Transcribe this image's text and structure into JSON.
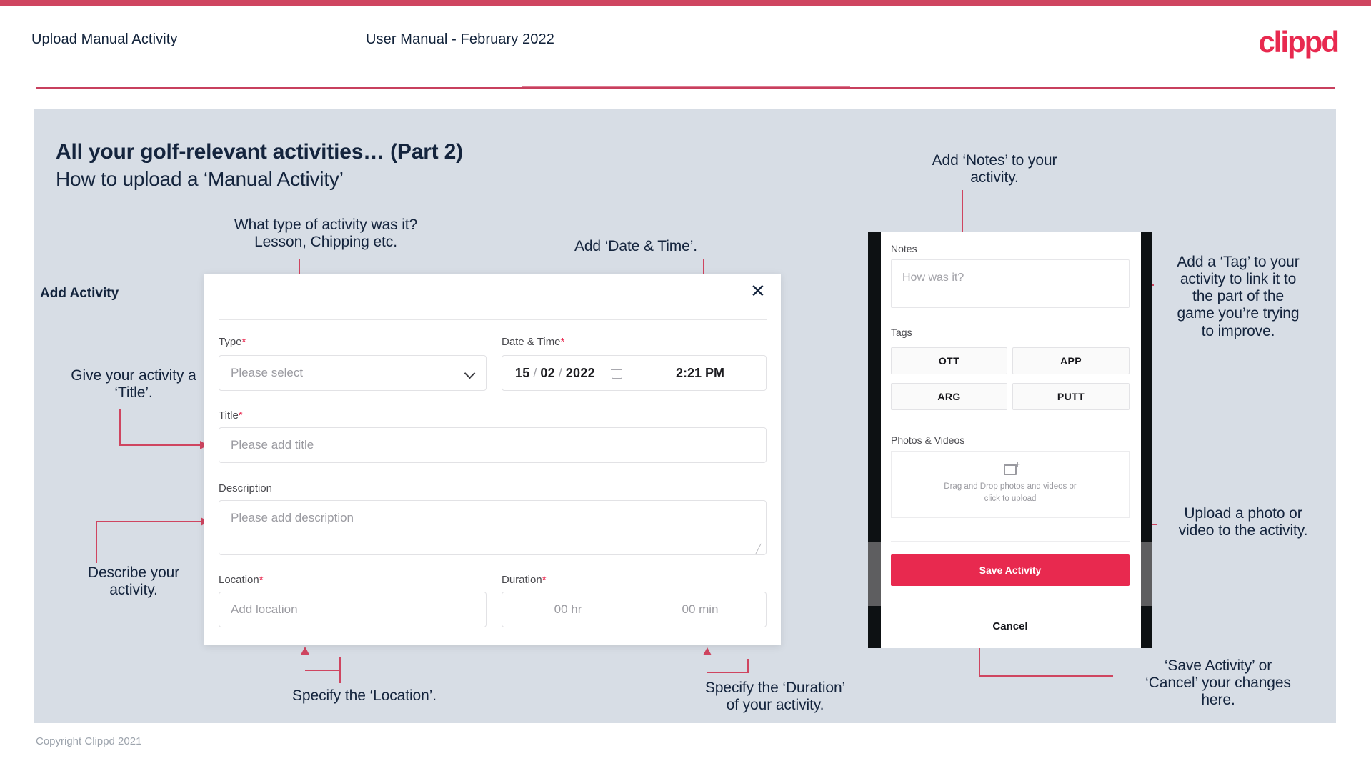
{
  "header": {
    "title": "Upload Manual Activity",
    "subtitle": "User Manual - February 2022",
    "logo": "clippd"
  },
  "slide": {
    "title": "All your golf-relevant activities… (Part 2)",
    "subtitle": "How to upload a ‘Manual Activity’"
  },
  "annotations": {
    "type": "What type of activity was it?\nLesson, Chipping etc.",
    "date_time": "Add ‘Date & Time’.",
    "title_field": "Give your activity a\n‘Title’.",
    "description": "Describe your\nactivity.",
    "location": "Specify the ‘Location’.",
    "duration": "Specify the ‘Duration’\nof your activity.",
    "notes": "Add ‘Notes’ to your\nactivity.",
    "tags": "Add a ‘Tag’ to your\nactivity to link it to\nthe part of the\ngame you’re trying\nto improve.",
    "photos": "Upload a photo or\nvideo to the activity.",
    "save_cancel": "‘Save Activity’ or\n‘Cancel’ your changes\nhere."
  },
  "dialog": {
    "title": "Add Activity",
    "close_icon": "close-icon",
    "fields": {
      "type": {
        "label": "Type",
        "required": "*",
        "placeholder": "Please select"
      },
      "date_time": {
        "label": "Date & Time",
        "required": "*",
        "day": "15",
        "month": "02",
        "year": "2022",
        "sep1": "/",
        "sep2": "/",
        "time": "2:21 PM"
      },
      "title": {
        "label": "Title",
        "required": "*",
        "placeholder": "Please add title"
      },
      "description": {
        "label": "Description",
        "placeholder": "Please add description"
      },
      "location": {
        "label": "Location",
        "required": "*",
        "placeholder": "Add location"
      },
      "duration": {
        "label": "Duration",
        "required": "*",
        "hours": "00 hr",
        "minutes": "00 min"
      }
    }
  },
  "phone": {
    "notes": {
      "label": "Notes",
      "placeholder": "How was it?"
    },
    "tags": {
      "label": "Tags",
      "items": [
        "OTT",
        "APP",
        "ARG",
        "PUTT"
      ]
    },
    "photos": {
      "label": "Photos & Videos",
      "drop_line1": "Drag and Drop photos and videos or",
      "drop_line2": "click to upload"
    },
    "save_label": "Save Activity",
    "cancel_label": "Cancel"
  },
  "footer": {
    "copyright": "Copyright Clippd 2021"
  },
  "colors": {
    "accent": "#e8294f",
    "rule": "#cf4560",
    "slide_bg": "#d7dde5",
    "text_dark": "#14243d"
  }
}
